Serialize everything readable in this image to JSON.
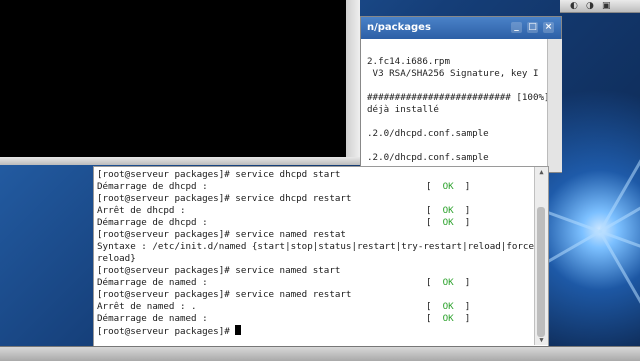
{
  "back_window": {
    "title": "n/packages",
    "lines": [
      "2.fc14.i686.rpm",
      " V3 RSA/SHA256 Signature, key I",
      "",
      "########################## [100%]",
      "déjà installé",
      "",
      ".2.0/dhcpd.conf.sample",
      "",
      ".2.0/dhcpd.conf.sample"
    ],
    "min_label": "_",
    "max_label": "□",
    "close_label": "×"
  },
  "terminal": {
    "lines": [
      {
        "text": "Démarrage de dhcpd :",
        "status": "[  OK  ]"
      },
      {
        "text": "[root@serveur packages]# service dhcpd restart",
        "status": ""
      },
      {
        "text": "Arrêt de dhcpd :",
        "status": "[  OK  ]"
      },
      {
        "text": "Démarrage de dhcpd :",
        "status": "[  OK  ]"
      },
      {
        "text": "[root@serveur packages]# service named restat",
        "status": ""
      },
      {
        "text": "Syntaxe : /etc/init.d/named {start|stop|status|restart|try-restart|reload|force-",
        "status": ""
      },
      {
        "text": "reload}",
        "status": ""
      },
      {
        "text": "[root@serveur packages]# service named start",
        "status": ""
      },
      {
        "text": "Démarrage de named :",
        "status": "[  OK  ]"
      },
      {
        "text": "[root@serveur packages]# service named restart",
        "status": ""
      },
      {
        "text": "Arrêt de named : .",
        "status": "[  OK  ]"
      },
      {
        "text": "Démarrage de named :",
        "status": "[  OK  ]"
      },
      {
        "text": "[root@serveur packages]# ",
        "status": ""
      }
    ],
    "top_line": "[root@serveur packages]# service dhcpd start"
  },
  "colors": {
    "ok_green": "#2fa32f",
    "title_blue": "#2c5fa6"
  }
}
